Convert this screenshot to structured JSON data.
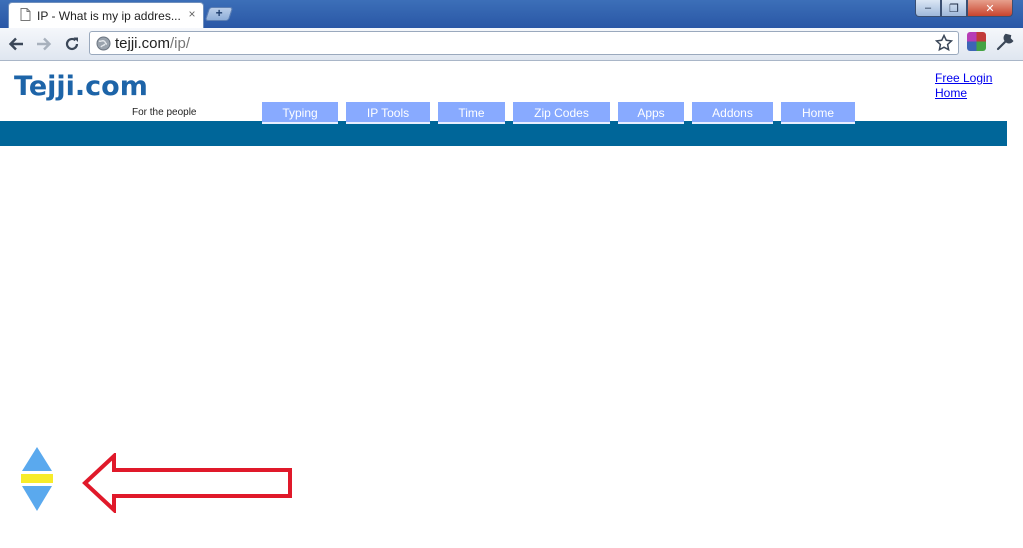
{
  "browser": {
    "tab": {
      "title": "IP - What is my ip addres...",
      "close_glyph": "×"
    },
    "new_tab_glyph": "+",
    "window_controls": {
      "minimize": "–",
      "maximize": "❐",
      "close": "✕"
    },
    "address": {
      "host": "tejji.com",
      "path": "/ip/"
    },
    "icons": [
      "back-icon",
      "forward-icon",
      "reload-icon",
      "globe-icon",
      "bookmark-star-icon",
      "extension-icon",
      "wrench-icon"
    ]
  },
  "site": {
    "logo": "Tejji.com",
    "tagline": "For the people",
    "nav": [
      {
        "label": "Typing"
      },
      {
        "label": "IP Tools"
      },
      {
        "label": "Time"
      },
      {
        "label": "Zip Codes"
      },
      {
        "label": "Apps"
      },
      {
        "label": "Addons"
      },
      {
        "label": "Home"
      }
    ],
    "top_links": {
      "login": "Free Login",
      "home": "Home"
    }
  },
  "colors": {
    "brand_blue": "#1d64a8",
    "header_bar": "#006699",
    "nav_bg": "#88aaff",
    "scroll_arrow": "#5aa9ee",
    "scroll_bar": "#f7ec2a",
    "annotation_arrow": "#e0192a"
  }
}
